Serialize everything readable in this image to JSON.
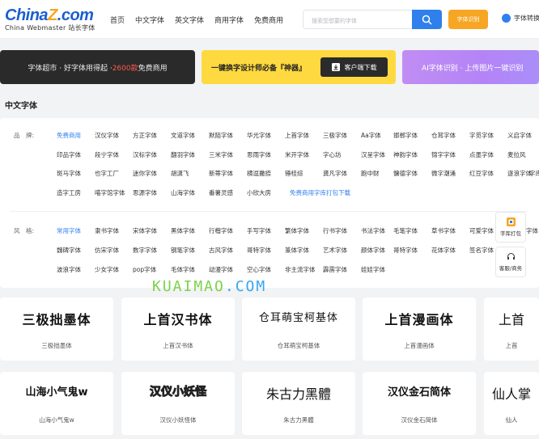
{
  "header": {
    "logo_main": "China",
    "logo_star": "Z",
    "logo_com": ".com",
    "logo_sub": "China Webmaster 站长字体",
    "nav": [
      "首页",
      "中文字体",
      "英文字体",
      "商用字体",
      "免费商用"
    ],
    "search_placeholder": "搜索您想要的字体",
    "identify_label": "字体识别",
    "convert_label": "字体转换"
  },
  "banners": {
    "b1_prefix": "字体超市 · 好字体用得起 · ",
    "b1_highlight": "2600款",
    "b1_suffix": "免费商用",
    "b2_text": "一键换字设计师必备『神器』",
    "b2_button": "客户端下载",
    "b3_text": "AI字体识别 · 上传图片一键识别"
  },
  "section_title": "中文字体",
  "filters": {
    "brand_label": "品　牌:",
    "brand_rows": [
      [
        "免费商用",
        "汉仪字体",
        "方正字体",
        "文道字体",
        "默陌字体",
        "华光字体",
        "上首字体",
        "三极字体",
        "Aa字体",
        "邯郸字体",
        "仓耳字体",
        "字觅字体",
        "义启字体"
      ],
      [
        "印品字体",
        "段宁字体",
        "汉标字体",
        "翻羽字体",
        "三米字体",
        "思雨字体",
        "米开字体",
        "字心坊",
        "汉呈字体",
        "神韵字体",
        "锦字字体",
        "点墨字体",
        "麦拉风"
      ],
      [
        "斑马字体",
        "也字工厂",
        "迷你字体",
        "胡潇飞",
        "新蒂字体",
        "横逗撇捺",
        "锤桂综",
        "龚凡字体",
        "跑中财",
        "慵德字体",
        "微字潮涌",
        "红豆字体",
        "逐浪字体",
        "字库"
      ],
      [
        "造字工房",
        "喵字馆字体",
        "思源字体",
        "山海字体",
        "番薯灵感",
        "小欣大房",
        "免费商用字库打包下载"
      ]
    ],
    "style_label": "风　格:",
    "style_rows": [
      [
        "常用字体",
        "隶书字体",
        "宋体字体",
        "黑体字体",
        "行楷字体",
        "手写字体",
        "繁体字体",
        "行书字体",
        "书法字体",
        "毛笔字体",
        "草书字体",
        "可爱字体",
        "字体"
      ],
      [
        "魏碑字体",
        "仿宋字体",
        "数字字体",
        "钢笔字体",
        "古风字体",
        "哥特字体",
        "篆体字体",
        "艺术字体",
        "颜体字体",
        "哥特字体",
        "花体字体",
        "签名字体"
      ],
      [
        "波浪字体",
        "少女字体",
        "pop字体",
        "毛体字体",
        "动漫字体",
        "空心字体",
        "非主流字体",
        "霹雳字体",
        "娃娃字体"
      ]
    ]
  },
  "floating": {
    "pack_label": "字库打包",
    "service_label": "客服/商务"
  },
  "watermark": {
    "part1": "KUAIMAO",
    "part2": ".COM"
  },
  "cards": [
    {
      "preview": "三极拙墨体",
      "name": "三极拙墨体"
    },
    {
      "preview": "上首汉书体",
      "name": "上首汉书体"
    },
    {
      "preview": "仓耳萌宝柯基体",
      "name": "仓耳萌宝柯基体"
    },
    {
      "preview": "上首漫画体",
      "name": "上首漫画体"
    },
    {
      "preview": "上首",
      "name": "上首"
    },
    {
      "preview": "山海小气鬼w",
      "name": "山海小气鬼w"
    },
    {
      "preview": "汉仪小妖怪",
      "name": "汉仪小妖怪体"
    },
    {
      "preview": "朱古力黑體",
      "name": "朱古力黑體"
    },
    {
      "preview": "汉仪金石简体",
      "name": "汉仪金石简体"
    },
    {
      "preview": "仙人掌",
      "name": "仙人"
    }
  ],
  "colors": {
    "accent": "#2f80ed",
    "orange": "#f7a623",
    "banner_yellow": "#ffd940",
    "banner_dark": "#2a2a2a",
    "banner_purple": "#b484f6"
  }
}
